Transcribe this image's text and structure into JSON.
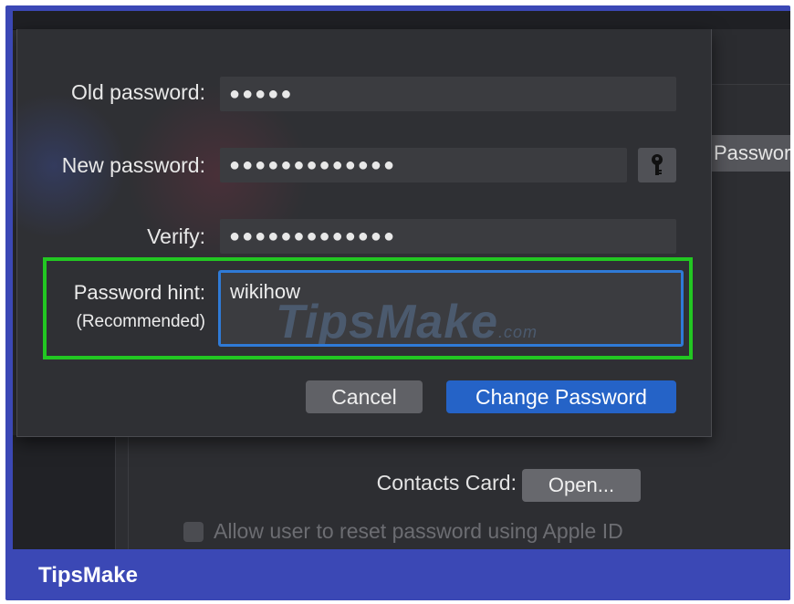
{
  "dialog": {
    "old_password_label": "Old password:",
    "old_password_value": "●●●●●",
    "new_password_label": "New password:",
    "new_password_value": "●●●●●●●●●●●●●",
    "verify_label": "Verify:",
    "verify_value": "●●●●●●●●●●●●●",
    "hint_label": "Password hint:",
    "hint_sublabel": "(Recommended)",
    "hint_value": "wikihow",
    "cancel_label": "Cancel",
    "change_label": "Change Password",
    "key_icon": "key-icon"
  },
  "background": {
    "password_button_label": "Passwor",
    "contacts_card_label": "Contacts Card:",
    "open_button_label": "Open...",
    "reset_checkbox_label": "Allow user to reset password using Apple ID"
  },
  "watermark": {
    "text": "TipsMake",
    "suffix": ".com"
  },
  "footer": {
    "brand": "TipsMake"
  },
  "colors": {
    "frame": "#3b48b5",
    "highlight": "#22c722",
    "focus": "#2f7ad6",
    "primary_button": "#2563c7"
  }
}
